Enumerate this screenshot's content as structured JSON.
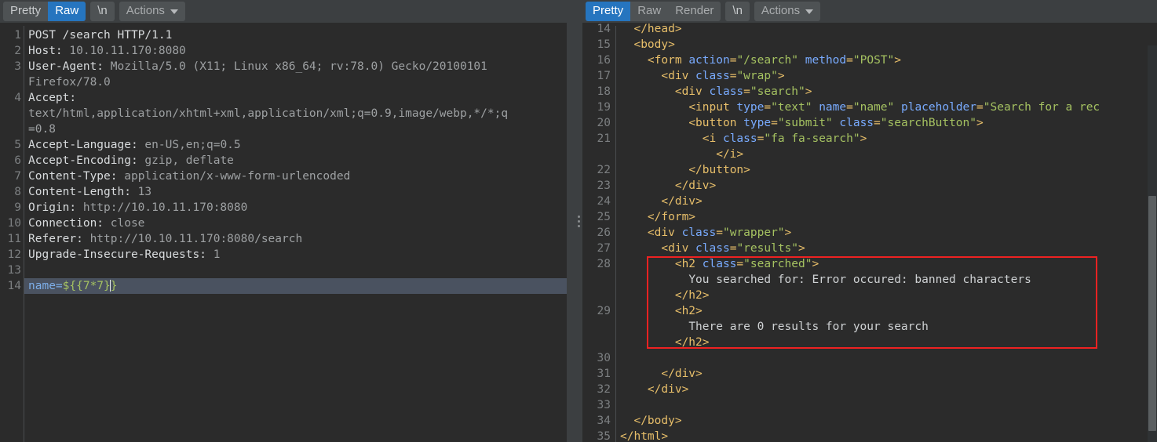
{
  "request_panel": {
    "toolbar": {
      "tabs": [
        {
          "label": "Pretty",
          "active": false
        },
        {
          "label": "Raw",
          "active": true
        }
      ],
      "newline_label": "\\n",
      "actions_label": "Actions",
      "caret_icon": "chevron-down-icon"
    },
    "lines": [
      {
        "num": "1",
        "type": "request-line",
        "method": "POST",
        "path": "/search",
        "version": "HTTP/1.1"
      },
      {
        "num": "2",
        "type": "header",
        "name": "Host:",
        "value": "10.10.11.170:8080"
      },
      {
        "num": "3",
        "type": "header",
        "name": "User-Agent:",
        "value": "Mozilla/5.0 (X11; Linux x86_64; rv:78.0) Gecko/20100101"
      },
      {
        "num": "",
        "type": "wrap",
        "value": "Firefox/78.0"
      },
      {
        "num": "4",
        "type": "header",
        "name": "Accept:",
        "value": ""
      },
      {
        "num": "",
        "type": "wrap",
        "value": "text/html,application/xhtml+xml,application/xml;q=0.9,image/webp,*/*;q"
      },
      {
        "num": "",
        "type": "wrap",
        "value": "=0.8"
      },
      {
        "num": "5",
        "type": "header",
        "name": "Accept-Language:",
        "value": "en-US,en;q=0.5"
      },
      {
        "num": "6",
        "type": "header",
        "name": "Accept-Encoding:",
        "value": "gzip, deflate"
      },
      {
        "num": "7",
        "type": "header",
        "name": "Content-Type:",
        "value": "application/x-www-form-urlencoded"
      },
      {
        "num": "8",
        "type": "header",
        "name": "Content-Length:",
        "value": "13"
      },
      {
        "num": "9",
        "type": "header",
        "name": "Origin:",
        "value": "http://10.10.11.170:8080"
      },
      {
        "num": "10",
        "type": "header",
        "name": "Connection:",
        "value": "close"
      },
      {
        "num": "11",
        "type": "header",
        "name": "Referer:",
        "value": "http://10.10.11.170:8080/search"
      },
      {
        "num": "12",
        "type": "header",
        "name": "Upgrade-Insecure-Requests:",
        "value": "1"
      },
      {
        "num": "13",
        "type": "blank",
        "value": ""
      },
      {
        "num": "14",
        "type": "body",
        "param_name": "name",
        "equals": "=",
        "param_value_pre": "${{7*7}",
        "param_value_post": "}"
      }
    ]
  },
  "response_panel": {
    "toolbar": {
      "tabs": [
        {
          "label": "Pretty",
          "active": true
        },
        {
          "label": "Raw",
          "active": false
        },
        {
          "label": "Render",
          "active": false
        }
      ],
      "newline_label": "\\n",
      "actions_label": "Actions",
      "caret_icon": "chevron-down-icon"
    },
    "lines": [
      {
        "num": "14",
        "indent": 2,
        "segments": [
          {
            "t": "tag",
            "v": "</head>"
          }
        ]
      },
      {
        "num": "15",
        "indent": 2,
        "segments": [
          {
            "t": "tag",
            "v": "<body>"
          }
        ]
      },
      {
        "num": "16",
        "indent": 4,
        "segments": [
          {
            "t": "tag",
            "v": "<form "
          },
          {
            "t": "attr",
            "v": "action"
          },
          {
            "t": "tag",
            "v": "="
          },
          {
            "t": "str",
            "v": "\"/search\""
          },
          {
            "t": "tag",
            "v": " "
          },
          {
            "t": "attr",
            "v": "method"
          },
          {
            "t": "tag",
            "v": "="
          },
          {
            "t": "str",
            "v": "\"POST\""
          },
          {
            "t": "tag",
            "v": ">"
          }
        ]
      },
      {
        "num": "17",
        "indent": 6,
        "segments": [
          {
            "t": "tag",
            "v": "<div "
          },
          {
            "t": "attr",
            "v": "class"
          },
          {
            "t": "tag",
            "v": "="
          },
          {
            "t": "str",
            "v": "\"wrap\""
          },
          {
            "t": "tag",
            "v": ">"
          }
        ]
      },
      {
        "num": "18",
        "indent": 8,
        "segments": [
          {
            "t": "tag",
            "v": "<div "
          },
          {
            "t": "attr",
            "v": "class"
          },
          {
            "t": "tag",
            "v": "="
          },
          {
            "t": "str",
            "v": "\"search\""
          },
          {
            "t": "tag",
            "v": ">"
          }
        ]
      },
      {
        "num": "19",
        "indent": 10,
        "segments": [
          {
            "t": "tag",
            "v": "<input "
          },
          {
            "t": "attr",
            "v": "type"
          },
          {
            "t": "tag",
            "v": "="
          },
          {
            "t": "str",
            "v": "\"text\""
          },
          {
            "t": "tag",
            "v": " "
          },
          {
            "t": "attr",
            "v": "name"
          },
          {
            "t": "tag",
            "v": "="
          },
          {
            "t": "str",
            "v": "\"name\""
          },
          {
            "t": "tag",
            "v": " "
          },
          {
            "t": "attr",
            "v": "placeholder"
          },
          {
            "t": "tag",
            "v": "="
          },
          {
            "t": "str",
            "v": "\"Search for a rec"
          }
        ]
      },
      {
        "num": "20",
        "indent": 10,
        "segments": [
          {
            "t": "tag",
            "v": "<button "
          },
          {
            "t": "attr",
            "v": "type"
          },
          {
            "t": "tag",
            "v": "="
          },
          {
            "t": "str",
            "v": "\"submit\""
          },
          {
            "t": "tag",
            "v": " "
          },
          {
            "t": "attr",
            "v": "class"
          },
          {
            "t": "tag",
            "v": "="
          },
          {
            "t": "str",
            "v": "\"searchButton\""
          },
          {
            "t": "tag",
            "v": ">"
          }
        ]
      },
      {
        "num": "21",
        "indent": 12,
        "segments": [
          {
            "t": "tag",
            "v": "<i "
          },
          {
            "t": "attr",
            "v": "class"
          },
          {
            "t": "tag",
            "v": "="
          },
          {
            "t": "str",
            "v": "\"fa fa-search\""
          },
          {
            "t": "tag",
            "v": ">"
          }
        ]
      },
      {
        "num": "",
        "indent": 14,
        "segments": [
          {
            "t": "tag",
            "v": "</i>"
          }
        ]
      },
      {
        "num": "22",
        "indent": 10,
        "segments": [
          {
            "t": "tag",
            "v": "</button>"
          }
        ]
      },
      {
        "num": "23",
        "indent": 8,
        "segments": [
          {
            "t": "tag",
            "v": "</div>"
          }
        ]
      },
      {
        "num": "24",
        "indent": 6,
        "segments": [
          {
            "t": "tag",
            "v": "</div>"
          }
        ]
      },
      {
        "num": "25",
        "indent": 4,
        "segments": [
          {
            "t": "tag",
            "v": "</form>"
          }
        ]
      },
      {
        "num": "26",
        "indent": 4,
        "segments": [
          {
            "t": "tag",
            "v": "<div "
          },
          {
            "t": "attr",
            "v": "class"
          },
          {
            "t": "tag",
            "v": "="
          },
          {
            "t": "str",
            "v": "\"wrapper\""
          },
          {
            "t": "tag",
            "v": ">"
          }
        ]
      },
      {
        "num": "27",
        "indent": 6,
        "segments": [
          {
            "t": "tag",
            "v": "<div "
          },
          {
            "t": "attr",
            "v": "class"
          },
          {
            "t": "tag",
            "v": "="
          },
          {
            "t": "str",
            "v": "\"results\""
          },
          {
            "t": "tag",
            "v": ">"
          }
        ]
      },
      {
        "num": "28",
        "indent": 8,
        "segments": [
          {
            "t": "tag",
            "v": "<h2 "
          },
          {
            "t": "attr",
            "v": "class"
          },
          {
            "t": "tag",
            "v": "="
          },
          {
            "t": "str",
            "v": "\"searched\""
          },
          {
            "t": "tag",
            "v": ">"
          }
        ]
      },
      {
        "num": "",
        "indent": 10,
        "segments": [
          {
            "t": "txt",
            "v": "You searched for: Error occured: banned characters"
          }
        ]
      },
      {
        "num": "",
        "indent": 8,
        "segments": [
          {
            "t": "tag",
            "v": "</h2>"
          }
        ]
      },
      {
        "num": "29",
        "indent": 8,
        "segments": [
          {
            "t": "tag",
            "v": "<h2>"
          }
        ]
      },
      {
        "num": "",
        "indent": 10,
        "segments": [
          {
            "t": "txt",
            "v": "There are 0 results for your search"
          }
        ]
      },
      {
        "num": "",
        "indent": 8,
        "segments": [
          {
            "t": "tag",
            "v": "</h2>"
          }
        ]
      },
      {
        "num": "30",
        "indent": 0,
        "segments": []
      },
      {
        "num": "31",
        "indent": 6,
        "segments": [
          {
            "t": "tag",
            "v": "</div>"
          }
        ]
      },
      {
        "num": "32",
        "indent": 4,
        "segments": [
          {
            "t": "tag",
            "v": "</div>"
          }
        ]
      },
      {
        "num": "33",
        "indent": 0,
        "segments": []
      },
      {
        "num": "34",
        "indent": 2,
        "segments": [
          {
            "t": "tag",
            "v": "</body>"
          }
        ]
      },
      {
        "num": "35",
        "indent": 0,
        "segments": [
          {
            "t": "tag",
            "v": "</html>"
          }
        ]
      }
    ],
    "annotation": {
      "shape": "rectangle",
      "color": "#ee2222",
      "highlights": [
        "You searched for: Error occured: banned characters",
        "There are 0 results for your search"
      ]
    }
  }
}
